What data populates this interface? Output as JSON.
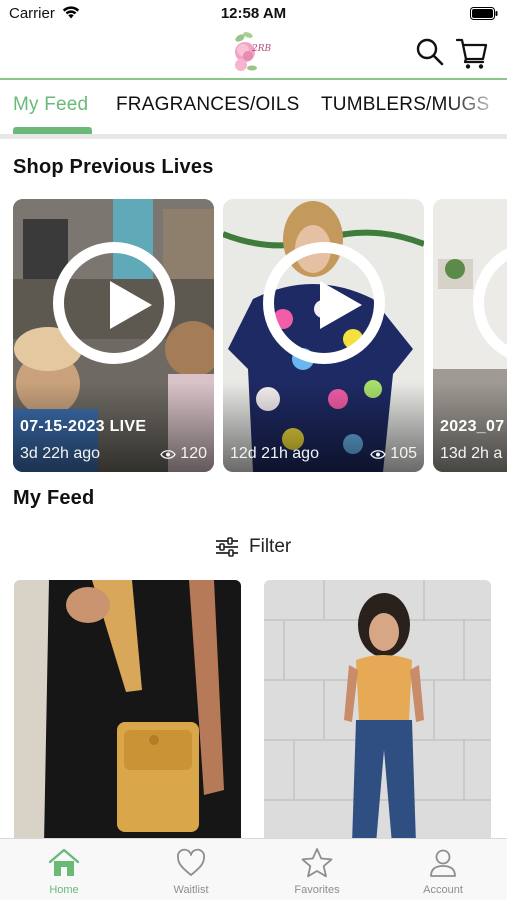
{
  "status_bar": {
    "carrier": "Carrier",
    "time": "12:58 AM"
  },
  "header": {
    "logo_text": "2RB",
    "search_icon": "search-icon",
    "cart_icon": "cart-icon"
  },
  "tabs": [
    {
      "label": "My Feed",
      "active": true
    },
    {
      "label": "FRAGRANCES/OILS",
      "active": false
    },
    {
      "label": "TUMBLERS/MUGS",
      "active": false
    }
  ],
  "shop_previous_lives": {
    "title": "Shop Previous Lives",
    "items": [
      {
        "title": "07-15-2023 LIVE",
        "ago": "3d 22h ago",
        "views": "120"
      },
      {
        "title": "",
        "ago": "12d 21h ago",
        "views": "105"
      },
      {
        "title": "2023_07",
        "ago": "13d 2h a",
        "views": ""
      }
    ]
  },
  "my_feed": {
    "title": "My Feed",
    "filter_label": "Filter"
  },
  "tab_bar": [
    {
      "label": "Home",
      "icon": "home-icon",
      "active": true
    },
    {
      "label": "Waitlist",
      "icon": "heart-icon",
      "active": false
    },
    {
      "label": "Favorites",
      "icon": "star-icon",
      "active": false
    },
    {
      "label": "Account",
      "icon": "person-icon",
      "active": false
    }
  ],
  "colors": {
    "accent": "#6bb979",
    "header_divider": "#8ac58d",
    "inactive": "#8e8e8e"
  }
}
